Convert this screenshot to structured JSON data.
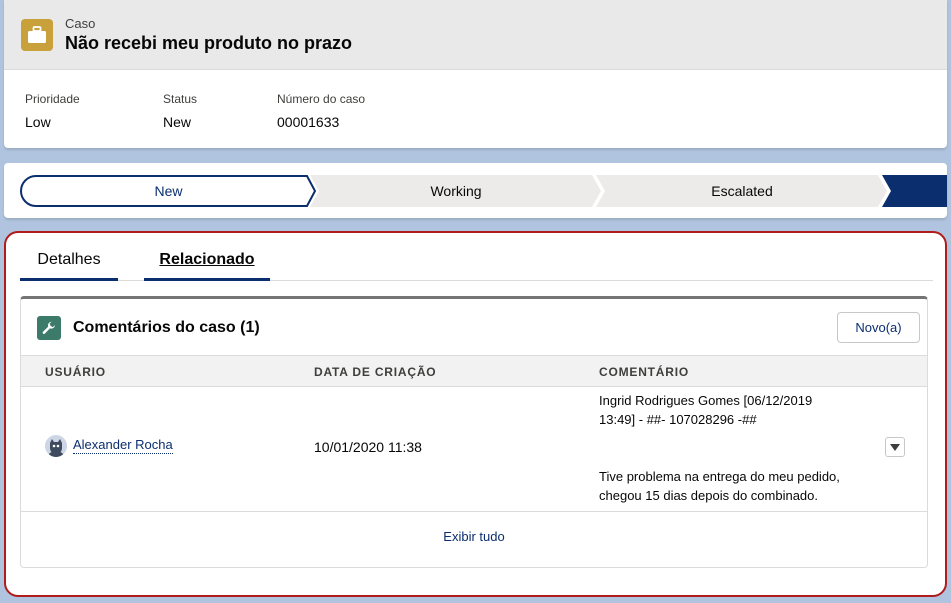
{
  "header": {
    "object_label": "Caso",
    "record_title": "Não recebi meu produto no prazo",
    "icon": "briefcase-icon",
    "icon_color": "#c8a13a",
    "fields": [
      {
        "label": "Prioridade",
        "value": "Low"
      },
      {
        "label": "Status",
        "value": "New"
      },
      {
        "label": "Número do caso",
        "value": "00001633"
      }
    ]
  },
  "path": {
    "steps": [
      {
        "label": "New",
        "state": "current"
      },
      {
        "label": "Working",
        "state": "incomplete"
      },
      {
        "label": "Escalated",
        "state": "incomplete"
      },
      {
        "label": "",
        "state": "closed"
      }
    ],
    "colors": {
      "current_border": "#0b2e6f",
      "incomplete": "#ecebea",
      "closed": "#0b2e6f"
    }
  },
  "tabs": [
    {
      "label": "Detalhes"
    },
    {
      "label": "Relacionado",
      "active": true
    }
  ],
  "related": {
    "title": "Comentários do caso (1)",
    "icon": "wrench-icon",
    "icon_color": "#3c7a6a",
    "new_button": "Novo(a)",
    "columns": [
      "USUÁRIO",
      "DATA DE CRIAÇÃO",
      "COMENTÁRIO"
    ],
    "rows": [
      {
        "user": "Alexander Rocha",
        "created": "10/01/2020 11:38",
        "comment_lines_1": [
          "Ingrid Rodrigues Gomes [06/12/2019",
          "13:49] - ##- 107028296 -##"
        ],
        "comment_lines_2": [
          "Tive problema na entrega do meu pedido,",
          "chegou 15 dias depois do combinado."
        ]
      }
    ],
    "view_all": "Exibir tudo"
  },
  "highlight_border_color": "#b01b1b"
}
